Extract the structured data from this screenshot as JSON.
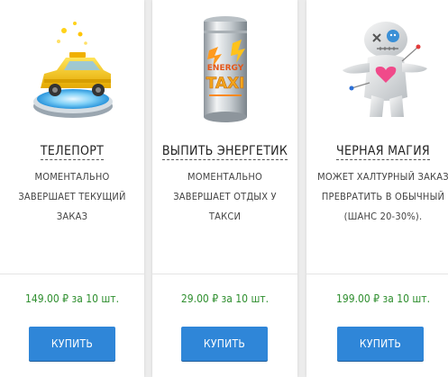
{
  "products": [
    {
      "title": "ТЕЛЕПОРТ",
      "description": "МОМЕНТАЛЬНО ЗАВЕРШАЕТ ТЕКУЩИЙ ЗАКАЗ",
      "price": "149.00 ₽ за 10 шт.",
      "button_label": "КУПИТЬ",
      "icon": "teleport-taxi-icon"
    },
    {
      "title": "ВЫПИТЬ ЭНЕРГЕТИК",
      "description": "МОМЕНТАЛЬНО ЗАВЕРШАЕТ ОТДЫХ У ТАКСИ",
      "price": "29.00 ₽ за 10 шт.",
      "button_label": "КУПИТЬ",
      "icon": "energy-drink-can-icon",
      "can_text_top": "ENERGY",
      "can_text_main": "TAXI"
    },
    {
      "title": "ЧЕРНАЯ МАГИЯ",
      "description": "МОЖЕТ ХАЛТУРНЫЙ ЗАКАЗ ПРЕВРАТИТЬ В ОБЫЧНЫЙ (ШАНС 20-30%).",
      "price": "199.00 ₽ за 10 шт.",
      "button_label": "КУПИТЬ",
      "icon": "voodoo-doll-icon"
    }
  ],
  "colors": {
    "price_green": "#2f8f2f",
    "button_blue": "#2f86d8",
    "taxi_yellow": "#f5c400",
    "portal_blue": "#3aa7e8"
  }
}
